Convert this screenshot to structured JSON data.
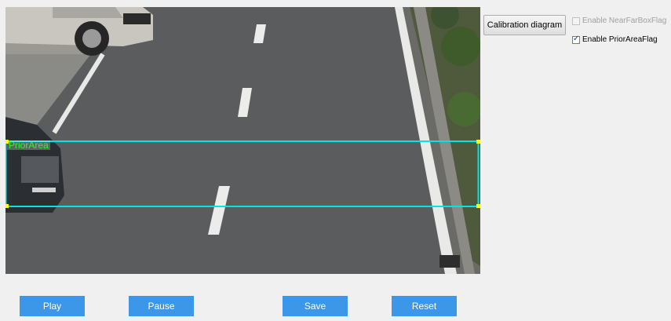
{
  "overlay": {
    "region_label": "PriorArea",
    "line_color": "#00e5e5",
    "handle_color": "#ffff00",
    "label_color": "#22ff22"
  },
  "side_panel": {
    "calibration_button": "Calibration diagram",
    "near_far_box_flag": {
      "label": "Enable NearFarBoxFlag",
      "checked": false,
      "enabled": false
    },
    "prior_area_flag": {
      "label": "Enable PriorAreaFlag",
      "checked": true,
      "enabled": true
    }
  },
  "controls": {
    "play": "Play",
    "pause": "Pause",
    "save": "Save",
    "reset": "Reset",
    "button_color": "#3d97e8"
  }
}
